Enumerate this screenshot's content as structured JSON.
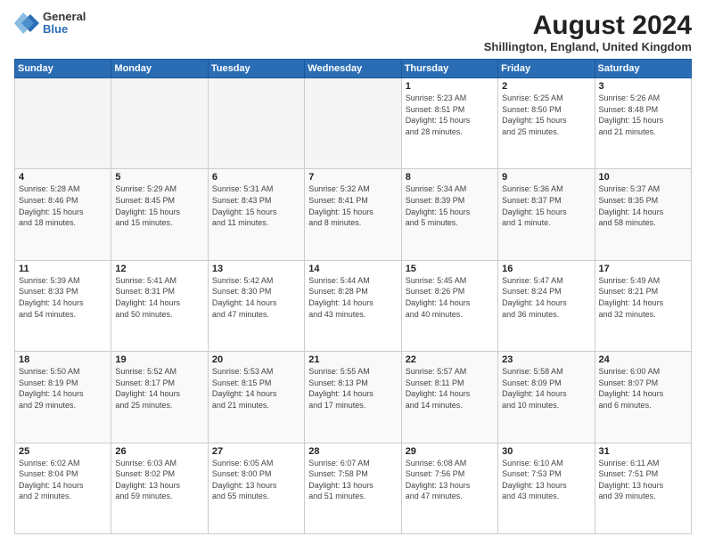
{
  "logo": {
    "general": "General",
    "blue": "Blue"
  },
  "title": "August 2024",
  "location": "Shillington, England, United Kingdom",
  "days_of_week": [
    "Sunday",
    "Monday",
    "Tuesday",
    "Wednesday",
    "Thursday",
    "Friday",
    "Saturday"
  ],
  "weeks": [
    [
      {
        "day": "",
        "info": ""
      },
      {
        "day": "",
        "info": ""
      },
      {
        "day": "",
        "info": ""
      },
      {
        "day": "",
        "info": ""
      },
      {
        "day": "1",
        "info": "Sunrise: 5:23 AM\nSunset: 8:51 PM\nDaylight: 15 hours\nand 28 minutes."
      },
      {
        "day": "2",
        "info": "Sunrise: 5:25 AM\nSunset: 8:50 PM\nDaylight: 15 hours\nand 25 minutes."
      },
      {
        "day": "3",
        "info": "Sunrise: 5:26 AM\nSunset: 8:48 PM\nDaylight: 15 hours\nand 21 minutes."
      }
    ],
    [
      {
        "day": "4",
        "info": "Sunrise: 5:28 AM\nSunset: 8:46 PM\nDaylight: 15 hours\nand 18 minutes."
      },
      {
        "day": "5",
        "info": "Sunrise: 5:29 AM\nSunset: 8:45 PM\nDaylight: 15 hours\nand 15 minutes."
      },
      {
        "day": "6",
        "info": "Sunrise: 5:31 AM\nSunset: 8:43 PM\nDaylight: 15 hours\nand 11 minutes."
      },
      {
        "day": "7",
        "info": "Sunrise: 5:32 AM\nSunset: 8:41 PM\nDaylight: 15 hours\nand 8 minutes."
      },
      {
        "day": "8",
        "info": "Sunrise: 5:34 AM\nSunset: 8:39 PM\nDaylight: 15 hours\nand 5 minutes."
      },
      {
        "day": "9",
        "info": "Sunrise: 5:36 AM\nSunset: 8:37 PM\nDaylight: 15 hours\nand 1 minute."
      },
      {
        "day": "10",
        "info": "Sunrise: 5:37 AM\nSunset: 8:35 PM\nDaylight: 14 hours\nand 58 minutes."
      }
    ],
    [
      {
        "day": "11",
        "info": "Sunrise: 5:39 AM\nSunset: 8:33 PM\nDaylight: 14 hours\nand 54 minutes."
      },
      {
        "day": "12",
        "info": "Sunrise: 5:41 AM\nSunset: 8:31 PM\nDaylight: 14 hours\nand 50 minutes."
      },
      {
        "day": "13",
        "info": "Sunrise: 5:42 AM\nSunset: 8:30 PM\nDaylight: 14 hours\nand 47 minutes."
      },
      {
        "day": "14",
        "info": "Sunrise: 5:44 AM\nSunset: 8:28 PM\nDaylight: 14 hours\nand 43 minutes."
      },
      {
        "day": "15",
        "info": "Sunrise: 5:45 AM\nSunset: 8:26 PM\nDaylight: 14 hours\nand 40 minutes."
      },
      {
        "day": "16",
        "info": "Sunrise: 5:47 AM\nSunset: 8:24 PM\nDaylight: 14 hours\nand 36 minutes."
      },
      {
        "day": "17",
        "info": "Sunrise: 5:49 AM\nSunset: 8:21 PM\nDaylight: 14 hours\nand 32 minutes."
      }
    ],
    [
      {
        "day": "18",
        "info": "Sunrise: 5:50 AM\nSunset: 8:19 PM\nDaylight: 14 hours\nand 29 minutes."
      },
      {
        "day": "19",
        "info": "Sunrise: 5:52 AM\nSunset: 8:17 PM\nDaylight: 14 hours\nand 25 minutes."
      },
      {
        "day": "20",
        "info": "Sunrise: 5:53 AM\nSunset: 8:15 PM\nDaylight: 14 hours\nand 21 minutes."
      },
      {
        "day": "21",
        "info": "Sunrise: 5:55 AM\nSunset: 8:13 PM\nDaylight: 14 hours\nand 17 minutes."
      },
      {
        "day": "22",
        "info": "Sunrise: 5:57 AM\nSunset: 8:11 PM\nDaylight: 14 hours\nand 14 minutes."
      },
      {
        "day": "23",
        "info": "Sunrise: 5:58 AM\nSunset: 8:09 PM\nDaylight: 14 hours\nand 10 minutes."
      },
      {
        "day": "24",
        "info": "Sunrise: 6:00 AM\nSunset: 8:07 PM\nDaylight: 14 hours\nand 6 minutes."
      }
    ],
    [
      {
        "day": "25",
        "info": "Sunrise: 6:02 AM\nSunset: 8:04 PM\nDaylight: 14 hours\nand 2 minutes."
      },
      {
        "day": "26",
        "info": "Sunrise: 6:03 AM\nSunset: 8:02 PM\nDaylight: 13 hours\nand 59 minutes."
      },
      {
        "day": "27",
        "info": "Sunrise: 6:05 AM\nSunset: 8:00 PM\nDaylight: 13 hours\nand 55 minutes."
      },
      {
        "day": "28",
        "info": "Sunrise: 6:07 AM\nSunset: 7:58 PM\nDaylight: 13 hours\nand 51 minutes."
      },
      {
        "day": "29",
        "info": "Sunrise: 6:08 AM\nSunset: 7:56 PM\nDaylight: 13 hours\nand 47 minutes."
      },
      {
        "day": "30",
        "info": "Sunrise: 6:10 AM\nSunset: 7:53 PM\nDaylight: 13 hours\nand 43 minutes."
      },
      {
        "day": "31",
        "info": "Sunrise: 6:11 AM\nSunset: 7:51 PM\nDaylight: 13 hours\nand 39 minutes."
      }
    ]
  ]
}
